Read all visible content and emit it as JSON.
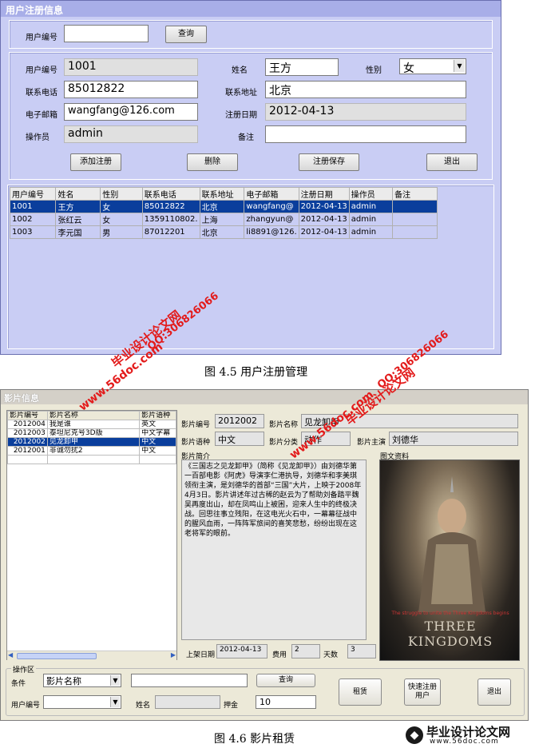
{
  "fig1": {
    "title": "用户注册信息",
    "search": {
      "label": "用户编号",
      "value": "",
      "button": "查询"
    },
    "fields": {
      "user_id": {
        "label": "用户编号",
        "value": "1001"
      },
      "name": {
        "label": "姓名",
        "value": "王方"
      },
      "gender": {
        "label": "性别",
        "value": "女"
      },
      "phone": {
        "label": "联系电话",
        "value": "85012822"
      },
      "address": {
        "label": "联系地址",
        "value": "北京"
      },
      "email": {
        "label": "电子邮箱",
        "value": "wangfang@126.com"
      },
      "reg_date": {
        "label": "注册日期",
        "value": "2012-04-13"
      },
      "operator": {
        "label": "操作员",
        "value": "admin"
      },
      "remark": {
        "label": "备注",
        "value": ""
      }
    },
    "buttons": {
      "add": "添加注册",
      "delete": "删除",
      "save": "注册保存",
      "exit": "退出"
    },
    "table": {
      "headers": [
        "用户编号",
        "姓名",
        "性别",
        "联系电话",
        "联系地址",
        "电子邮箱",
        "注册日期",
        "操作员",
        "备注"
      ],
      "rows": [
        [
          "1001",
          "王方",
          "女",
          "85012822",
          "北京",
          "wangfang@",
          "2012-04-13",
          "admin",
          ""
        ],
        [
          "1002",
          "张红云",
          "女",
          "1359110802.",
          "上海",
          "zhangyun@",
          "2012-04-13",
          "admin",
          ""
        ],
        [
          "1003",
          "李元国",
          "男",
          "87012201",
          "北京",
          "li8891@126.",
          "2012-04-13",
          "admin",
          ""
        ]
      ]
    },
    "caption": "图 4.5  用户注册管理"
  },
  "watermark": {
    "site_a": "www.56doc.com",
    "brand": "毕业设计论文网",
    "qq": "QQ:306826066",
    "footer_brand": "毕业设计论文网",
    "footer_site": "www.56doc.com"
  },
  "fig2": {
    "title": "影片信息",
    "table": {
      "headers": [
        "影片编号",
        "影片名称",
        "影片语种"
      ],
      "rows": [
        [
          "2012004",
          "我是谁",
          "英文"
        ],
        [
          "2012003",
          "泰坦尼克号3D版",
          "中文字幕"
        ],
        [
          "2012002",
          "见龙卸甲",
          "中文"
        ],
        [
          "2012001",
          "非诚勿扰2",
          "中文"
        ]
      ]
    },
    "detail": {
      "film_id": {
        "label": "影片编号",
        "value": "2012002"
      },
      "film_name": {
        "label": "影片名称",
        "value": "见龙卸甲"
      },
      "language": {
        "label": "影片语种",
        "value": "中文"
      },
      "category": {
        "label": "影片分类",
        "value": "动作"
      },
      "lead": {
        "label": "影片主演",
        "value": "刘德华"
      },
      "intro_label": "影片简介",
      "intro": "《三国志之见龙卸甲》（简称《见龙卸甲》）由刘德华第一百部电影《阿虎》导演李仁港执导，刘德华和李美琪领衔主演，是刘德华的首部“三国”大片，上映于2008年4月3日。影片讲述年过古稀的赵云为了帮助刘备踏平魏吴再度出山，却在凤鸣山上被困，迎来人生中的终极决战。回思往事立残阳，在这电光火石中，一幕幕征战中的腥风血雨，一阵阵军旅间的喜笑悲愁，纷纷出现在这老将军的眼前。",
      "poster_label": "图文资料",
      "poster_text": "THREE KINGDOMS",
      "poster_tagline": "The struggle to unite the Three Kingdoms begins",
      "release": {
        "label": "上架日期",
        "value": "2012-04-13"
      },
      "fee": {
        "label": "费用",
        "value": "2"
      },
      "days": {
        "label": "天数",
        "value": "3"
      }
    },
    "ops": {
      "group": "操作区",
      "cond_label": "条件",
      "cond_value": "影片名称",
      "query_value": "",
      "query_btn": "查询",
      "rent_btn": "租赁",
      "quick_btn": "快速注册用户",
      "exit_btn": "退出",
      "user_label": "用户编号",
      "user_value": "",
      "name_label": "姓名",
      "name_value": "",
      "deposit_label": "押金",
      "deposit_value": "10"
    },
    "caption": "图 4.6  影片租赁"
  }
}
